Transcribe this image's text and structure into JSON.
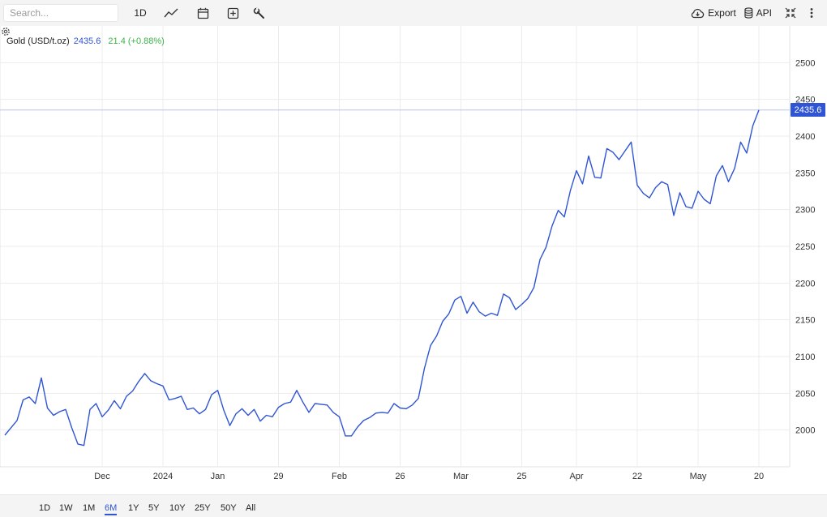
{
  "toolbar": {
    "search_placeholder": "Search...",
    "interval_label": "1D",
    "export_label": "Export",
    "api_label": "API",
    "icons": [
      "line-chart-icon",
      "calendar-icon",
      "add-box-icon",
      "wrench-icon",
      "cloud-download-icon",
      "database-icon",
      "collapse-icon",
      "more-vertical-icon"
    ]
  },
  "legend": {
    "symbol": "Gold (USD/t.oz)",
    "price": "2435.6",
    "change": "21.4 (+0.88%)"
  },
  "colors": {
    "line": "#2f55d4",
    "up": "#3cb34a",
    "grid": "#ececec",
    "toolbar_bg": "#f4f4f4"
  },
  "chart_data": {
    "type": "line",
    "ylim": [
      1950,
      2550
    ],
    "yticks": [
      2000,
      2050,
      2100,
      2150,
      2200,
      2250,
      2300,
      2350,
      2400,
      2450,
      2500
    ],
    "xticks": [
      {
        "i": 16,
        "label": "Dec"
      },
      {
        "i": 26,
        "label": "2024"
      },
      {
        "i": 35,
        "label": "Jan"
      },
      {
        "i": 45,
        "label": "29"
      },
      {
        "i": 55,
        "label": "Feb"
      },
      {
        "i": 65,
        "label": "26"
      },
      {
        "i": 75,
        "label": "Mar"
      },
      {
        "i": 85,
        "label": "25"
      },
      {
        "i": 94,
        "label": "Apr"
      },
      {
        "i": 104,
        "label": "22"
      },
      {
        "i": 114,
        "label": "May"
      },
      {
        "i": 124,
        "label": "20"
      }
    ],
    "last_value": 2435.6,
    "series": [
      {
        "values": [
          1993,
          2003,
          2013,
          2041,
          2045,
          2036,
          2071,
          2030,
          2020,
          2025,
          2028,
          2003,
          1981,
          1979,
          2028,
          2036,
          2018,
          2027,
          2040,
          2029,
          2046,
          2053,
          2066,
          2077,
          2067,
          2063,
          2060,
          2041,
          2043,
          2046,
          2028,
          2030,
          2022,
          2028,
          2048,
          2054,
          2027,
          2006,
          2022,
          2029,
          2020,
          2028,
          2012,
          2020,
          2018,
          2031,
          2036,
          2038,
          2054,
          2038,
          2024,
          2036,
          2035,
          2034,
          2024,
          2018,
          1992,
          1992,
          2004,
          2013,
          2017,
          2023,
          2024,
          2023,
          2036,
          2030,
          2029,
          2034,
          2043,
          2084,
          2115,
          2128,
          2148,
          2158,
          2177,
          2182,
          2159,
          2174,
          2161,
          2155,
          2159,
          2156,
          2185,
          2180,
          2164,
          2171,
          2179,
          2194,
          2232,
          2249,
          2278,
          2299,
          2290,
          2326,
          2353,
          2335,
          2373,
          2344,
          2343,
          2383,
          2378,
          2368,
          2380,
          2392,
          2333,
          2322,
          2316,
          2330,
          2338,
          2334,
          2292,
          2323,
          2304,
          2302,
          2325,
          2314,
          2308,
          2346,
          2360,
          2338,
          2356,
          2392,
          2377,
          2414,
          2435.6
        ]
      }
    ],
    "legend": "top-left"
  },
  "ranges": [
    "1D",
    "1W",
    "1M",
    "6M",
    "1Y",
    "5Y",
    "10Y",
    "25Y",
    "50Y",
    "All"
  ],
  "active_range": "6M"
}
